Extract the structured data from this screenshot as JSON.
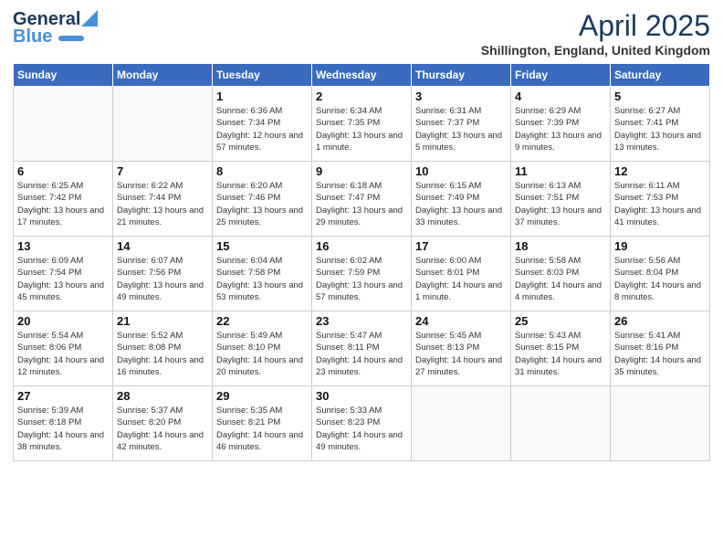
{
  "header": {
    "logo_general": "General",
    "logo_blue": "Blue",
    "month_title": "April 2025",
    "location": "Shillington, England, United Kingdom"
  },
  "days_of_week": [
    "Sunday",
    "Monday",
    "Tuesday",
    "Wednesday",
    "Thursday",
    "Friday",
    "Saturday"
  ],
  "weeks": [
    [
      {
        "day": "",
        "info": ""
      },
      {
        "day": "",
        "info": ""
      },
      {
        "day": "1",
        "info": "Sunrise: 6:36 AM\nSunset: 7:34 PM\nDaylight: 12 hours and 57 minutes."
      },
      {
        "day": "2",
        "info": "Sunrise: 6:34 AM\nSunset: 7:35 PM\nDaylight: 13 hours and 1 minute."
      },
      {
        "day": "3",
        "info": "Sunrise: 6:31 AM\nSunset: 7:37 PM\nDaylight: 13 hours and 5 minutes."
      },
      {
        "day": "4",
        "info": "Sunrise: 6:29 AM\nSunset: 7:39 PM\nDaylight: 13 hours and 9 minutes."
      },
      {
        "day": "5",
        "info": "Sunrise: 6:27 AM\nSunset: 7:41 PM\nDaylight: 13 hours and 13 minutes."
      }
    ],
    [
      {
        "day": "6",
        "info": "Sunrise: 6:25 AM\nSunset: 7:42 PM\nDaylight: 13 hours and 17 minutes."
      },
      {
        "day": "7",
        "info": "Sunrise: 6:22 AM\nSunset: 7:44 PM\nDaylight: 13 hours and 21 minutes."
      },
      {
        "day": "8",
        "info": "Sunrise: 6:20 AM\nSunset: 7:46 PM\nDaylight: 13 hours and 25 minutes."
      },
      {
        "day": "9",
        "info": "Sunrise: 6:18 AM\nSunset: 7:47 PM\nDaylight: 13 hours and 29 minutes."
      },
      {
        "day": "10",
        "info": "Sunrise: 6:15 AM\nSunset: 7:49 PM\nDaylight: 13 hours and 33 minutes."
      },
      {
        "day": "11",
        "info": "Sunrise: 6:13 AM\nSunset: 7:51 PM\nDaylight: 13 hours and 37 minutes."
      },
      {
        "day": "12",
        "info": "Sunrise: 6:11 AM\nSunset: 7:53 PM\nDaylight: 13 hours and 41 minutes."
      }
    ],
    [
      {
        "day": "13",
        "info": "Sunrise: 6:09 AM\nSunset: 7:54 PM\nDaylight: 13 hours and 45 minutes."
      },
      {
        "day": "14",
        "info": "Sunrise: 6:07 AM\nSunset: 7:56 PM\nDaylight: 13 hours and 49 minutes."
      },
      {
        "day": "15",
        "info": "Sunrise: 6:04 AM\nSunset: 7:58 PM\nDaylight: 13 hours and 53 minutes."
      },
      {
        "day": "16",
        "info": "Sunrise: 6:02 AM\nSunset: 7:59 PM\nDaylight: 13 hours and 57 minutes."
      },
      {
        "day": "17",
        "info": "Sunrise: 6:00 AM\nSunset: 8:01 PM\nDaylight: 14 hours and 1 minute."
      },
      {
        "day": "18",
        "info": "Sunrise: 5:58 AM\nSunset: 8:03 PM\nDaylight: 14 hours and 4 minutes."
      },
      {
        "day": "19",
        "info": "Sunrise: 5:56 AM\nSunset: 8:04 PM\nDaylight: 14 hours and 8 minutes."
      }
    ],
    [
      {
        "day": "20",
        "info": "Sunrise: 5:54 AM\nSunset: 8:06 PM\nDaylight: 14 hours and 12 minutes."
      },
      {
        "day": "21",
        "info": "Sunrise: 5:52 AM\nSunset: 8:08 PM\nDaylight: 14 hours and 16 minutes."
      },
      {
        "day": "22",
        "info": "Sunrise: 5:49 AM\nSunset: 8:10 PM\nDaylight: 14 hours and 20 minutes."
      },
      {
        "day": "23",
        "info": "Sunrise: 5:47 AM\nSunset: 8:11 PM\nDaylight: 14 hours and 23 minutes."
      },
      {
        "day": "24",
        "info": "Sunrise: 5:45 AM\nSunset: 8:13 PM\nDaylight: 14 hours and 27 minutes."
      },
      {
        "day": "25",
        "info": "Sunrise: 5:43 AM\nSunset: 8:15 PM\nDaylight: 14 hours and 31 minutes."
      },
      {
        "day": "26",
        "info": "Sunrise: 5:41 AM\nSunset: 8:16 PM\nDaylight: 14 hours and 35 minutes."
      }
    ],
    [
      {
        "day": "27",
        "info": "Sunrise: 5:39 AM\nSunset: 8:18 PM\nDaylight: 14 hours and 38 minutes."
      },
      {
        "day": "28",
        "info": "Sunrise: 5:37 AM\nSunset: 8:20 PM\nDaylight: 14 hours and 42 minutes."
      },
      {
        "day": "29",
        "info": "Sunrise: 5:35 AM\nSunset: 8:21 PM\nDaylight: 14 hours and 46 minutes."
      },
      {
        "day": "30",
        "info": "Sunrise: 5:33 AM\nSunset: 8:23 PM\nDaylight: 14 hours and 49 minutes."
      },
      {
        "day": "",
        "info": ""
      },
      {
        "day": "",
        "info": ""
      },
      {
        "day": "",
        "info": ""
      }
    ]
  ]
}
